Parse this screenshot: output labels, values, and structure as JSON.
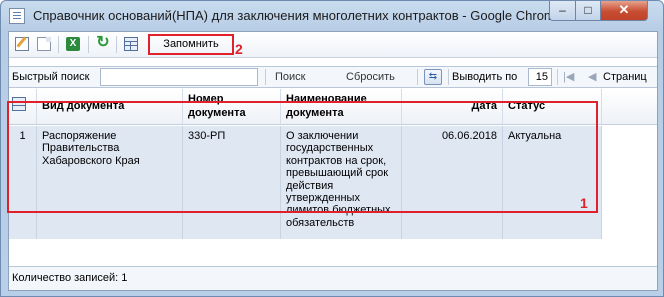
{
  "window": {
    "title": "Справочник оснований(НПА) для заключения многолетних контрактов - Google Chrome",
    "min_glyph": "–",
    "max_glyph": "□",
    "close_glyph": "✕"
  },
  "toolbar": {
    "remember_label": "Запомнить",
    "excel_glyph": "X",
    "refresh_glyph": "↻"
  },
  "search": {
    "label": "Быстрый поиск",
    "value": "",
    "search_label": "Поиск",
    "reset_label": "Сбросить",
    "per_page_label": "Выводить по",
    "per_page_value": "15",
    "first_glyph": "|◀",
    "prev_glyph": "◀",
    "page_label": "Страниц",
    "settings_glyph": "⇆"
  },
  "grid": {
    "columns": [
      "Вид документа",
      "Номер документа",
      "Наименование документа",
      "Дата",
      "Статус"
    ],
    "rows": [
      {
        "num": "1",
        "doc_type": "Распоряжение Правительства Хабаровского Края",
        "doc_number": "330-РП",
        "doc_name": "О заключении государственных контрактов на срок, превышающий срок действия утвержденных лимитов бюджетных обязательств",
        "date": "06.06.2018",
        "status": "Актуальна"
      }
    ]
  },
  "footer": {
    "count_label": "Количество записей: 1"
  },
  "annotations": {
    "marker_1": "1",
    "marker_2": "2",
    "color": "#e0202a"
  }
}
